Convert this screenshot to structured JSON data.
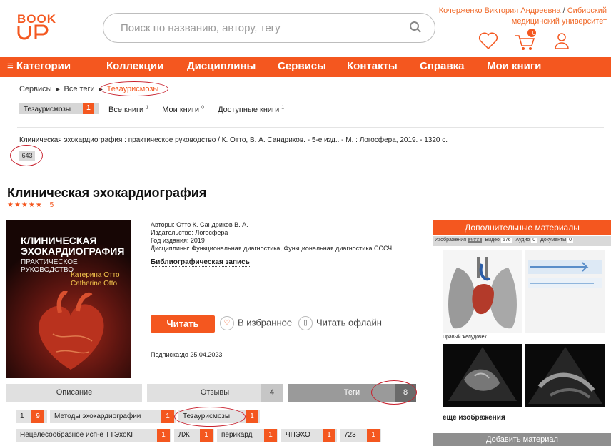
{
  "logo": {
    "top": "BOOK",
    "bottom": "UP"
  },
  "search": {
    "placeholder": "Поиск по названию, автору, тегу"
  },
  "user": {
    "name": "Кочерженко Виктория Андреевна",
    "separator": "/",
    "org": "Сибирский медицинский университет"
  },
  "cart": {
    "count": "0"
  },
  "nav": {
    "items": [
      "≡ Категории",
      "Коллекции",
      "Дисциплины",
      "Сервисы",
      "Контакты",
      "Справка",
      "Мои книги"
    ]
  },
  "breadcrumb": {
    "items": [
      "Сервисы",
      "Все теги",
      "Тезаурисмозы"
    ]
  },
  "tag_chip": {
    "label": "Тезаурисмозы",
    "count": "1"
  },
  "filters": {
    "all": {
      "label": "Все книги",
      "count": "1"
    },
    "mine": {
      "label": "Мои книги",
      "count": "0"
    },
    "available": {
      "label": "Доступные книги",
      "count": "1"
    }
  },
  "bib_text": "Клиническая эхокардиография : практическое руководство / К. Отто, В. А. Сандриков. - 5-е изд.. - М. : Логосфера, 2019. - 1320 с.",
  "num_chip": "643",
  "book": {
    "title": "Клиническая эхокардиография",
    "stars": "★★★★★",
    "rating": "5",
    "cover": {
      "title1": "КЛИНИЧЕСКАЯ",
      "title2": "ЭХОКАРДИОГРАФИЯ",
      "subtitle": "ПРАКТИЧЕСКОЕ РУКОВОДСТВО",
      "author1": "Катерина Отто",
      "author2": "Catherine Otto"
    },
    "authors": "Авторы: Отто К. Сандриков В. А.",
    "publisher": "Издательство: Логосфера",
    "year": "Год издания: 2019",
    "disciplines": "Дисциплины: Функциональная диагностика, Функциональная диагностика СССЧ",
    "bib_link": "Библиографическая запись",
    "read": "Читать",
    "favorite": "В избранное",
    "offline": "Читать офлайн",
    "subscription": "Подписка:до 25.04.2023"
  },
  "tabs": [
    {
      "label": "Описание"
    },
    {
      "label": "Отзывы",
      "count": "4"
    },
    {
      "label": "Теги",
      "count": "8"
    }
  ],
  "tags": [
    {
      "label": "1",
      "count": "9"
    },
    {
      "label": "Методы эхокардиографии",
      "count": "1"
    },
    {
      "label": "Тезаурисмозы",
      "count": "1"
    },
    {
      "label": "Нецелесообразное исп-е ТТЭхоКГ",
      "count": "1"
    },
    {
      "label": "ЛЖ",
      "count": "1"
    },
    {
      "label": "перикард",
      "count": "1"
    },
    {
      "label": "ЧПЭХО",
      "count": "1"
    },
    {
      "label": "723",
      "count": "1"
    }
  ],
  "panel": {
    "title": "Дополнительные материалы",
    "tabs": [
      {
        "label": "Изображения",
        "count": "1598"
      },
      {
        "label": "Видео",
        "count": "576"
      },
      {
        "label": "Аудио",
        "count": "0"
      },
      {
        "label": "Документы",
        "count": "0"
      }
    ],
    "caption": "Правый желудочек",
    "more": "ещё изображения",
    "add": "Добавить материал"
  },
  "colors": {
    "accent": "#f4571f",
    "highlight_ring": "#c8202d"
  }
}
